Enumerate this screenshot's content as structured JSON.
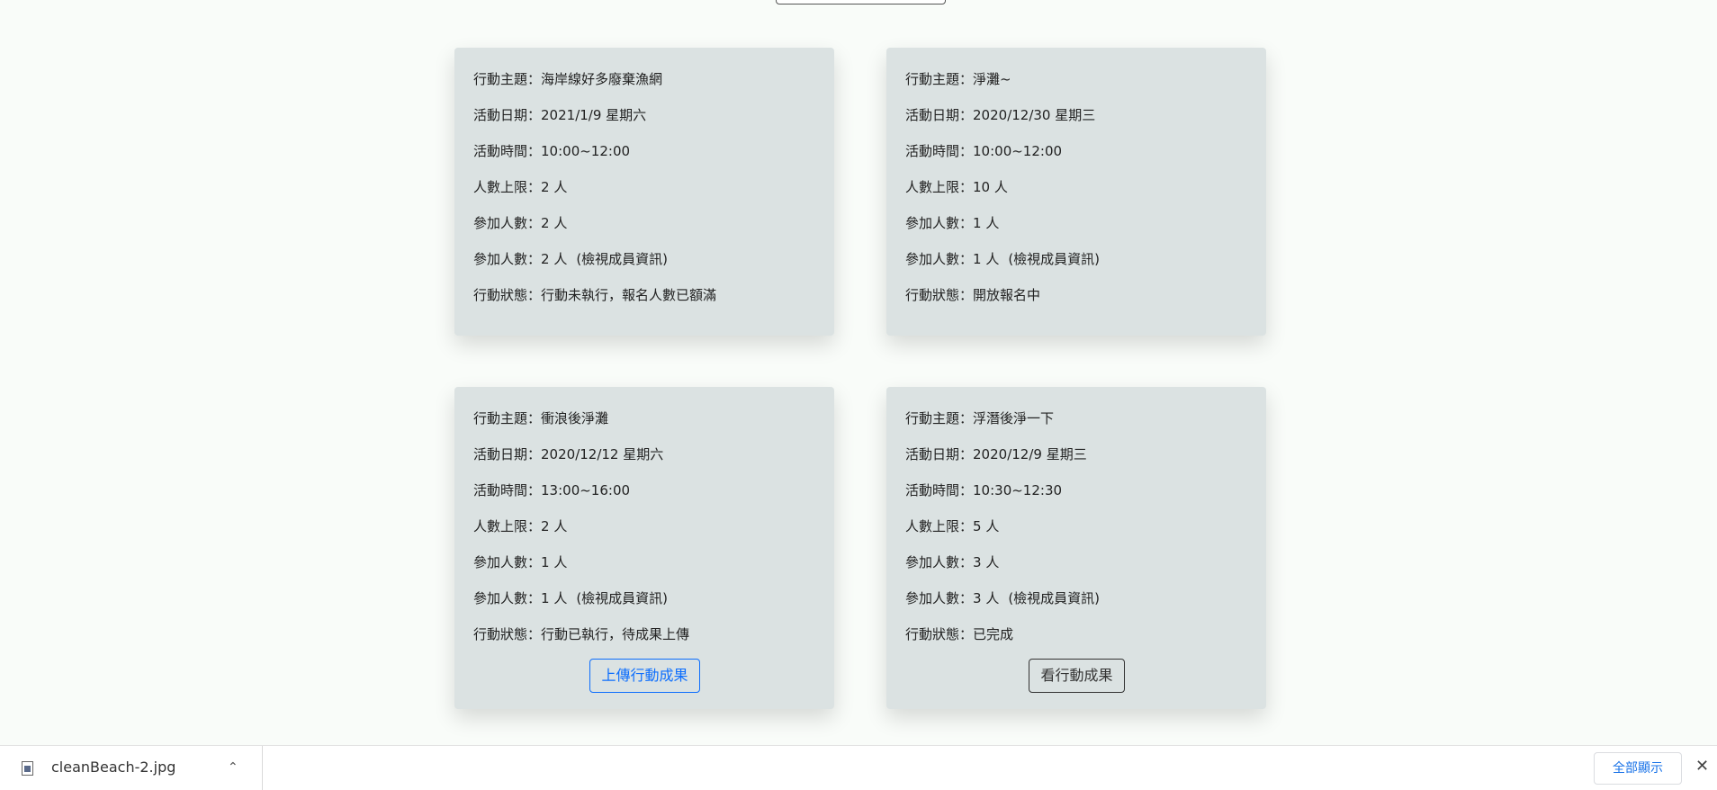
{
  "cards": [
    {
      "theme_label": "行動主題：",
      "theme": "海岸線好多廢棄漁網",
      "date_label": "活動日期：",
      "date": "2021/1/9 星期六",
      "time_label": "活動時間：",
      "time": "10:00~12:00",
      "limit_label": "人數上限：",
      "limit": "2 人",
      "joined_label": "參加人數：",
      "joined": "2 人",
      "joined2_label": "參加人數：",
      "joined2": "2 人",
      "member_link": "(檢視成員資訊)",
      "status_label": "行動狀態：",
      "status": "行動未執行，報名人數已額滿"
    },
    {
      "theme_label": "行動主題：",
      "theme": "淨灘~",
      "date_label": "活動日期：",
      "date": "2020/12/30 星期三",
      "time_label": "活動時間：",
      "time": "10:00~12:00",
      "limit_label": "人數上限：",
      "limit": "10 人",
      "joined_label": "參加人數：",
      "joined": "1 人",
      "joined2_label": "參加人數：",
      "joined2": "1 人",
      "member_link": "(檢視成員資訊)",
      "status_label": "行動狀態：",
      "status": "開放報名中"
    },
    {
      "theme_label": "行動主題：",
      "theme": "衝浪後淨灘",
      "date_label": "活動日期：",
      "date": "2020/12/12 星期六",
      "time_label": "活動時間：",
      "time": "13:00~16:00",
      "limit_label": "人數上限：",
      "limit": "2 人",
      "joined_label": "參加人數：",
      "joined": "1 人",
      "joined2_label": "參加人數：",
      "joined2": "1 人",
      "member_link": "(檢視成員資訊)",
      "status_label": "行動狀態：",
      "status": "行動已執行，待成果上傳",
      "button": "上傳行動成果"
    },
    {
      "theme_label": "行動主題：",
      "theme": "浮潛後淨一下",
      "date_label": "活動日期：",
      "date": "2020/12/9 星期三",
      "time_label": "活動時間：",
      "time": "10:30~12:30",
      "limit_label": "人數上限：",
      "limit": "5 人",
      "joined_label": "參加人數：",
      "joined": "3 人",
      "joined2_label": "參加人數：",
      "joined2": "3 人",
      "member_link": "(檢視成員資訊)",
      "status_label": "行動狀態：",
      "status": "已完成",
      "button": "看行動成果"
    }
  ],
  "download_bar": {
    "file_name": "cleanBeach-2.jpg",
    "file_icon": "image-file-icon",
    "chevron_icon": "chevron-up-icon",
    "show_all": "全部顯示",
    "close_icon": "close-icon"
  },
  "colors": {
    "page_bg": "#f9fcf9",
    "card_bg": "#dbe2e2",
    "primary": "#0d6efd",
    "link_blue": "#1a73e8"
  }
}
